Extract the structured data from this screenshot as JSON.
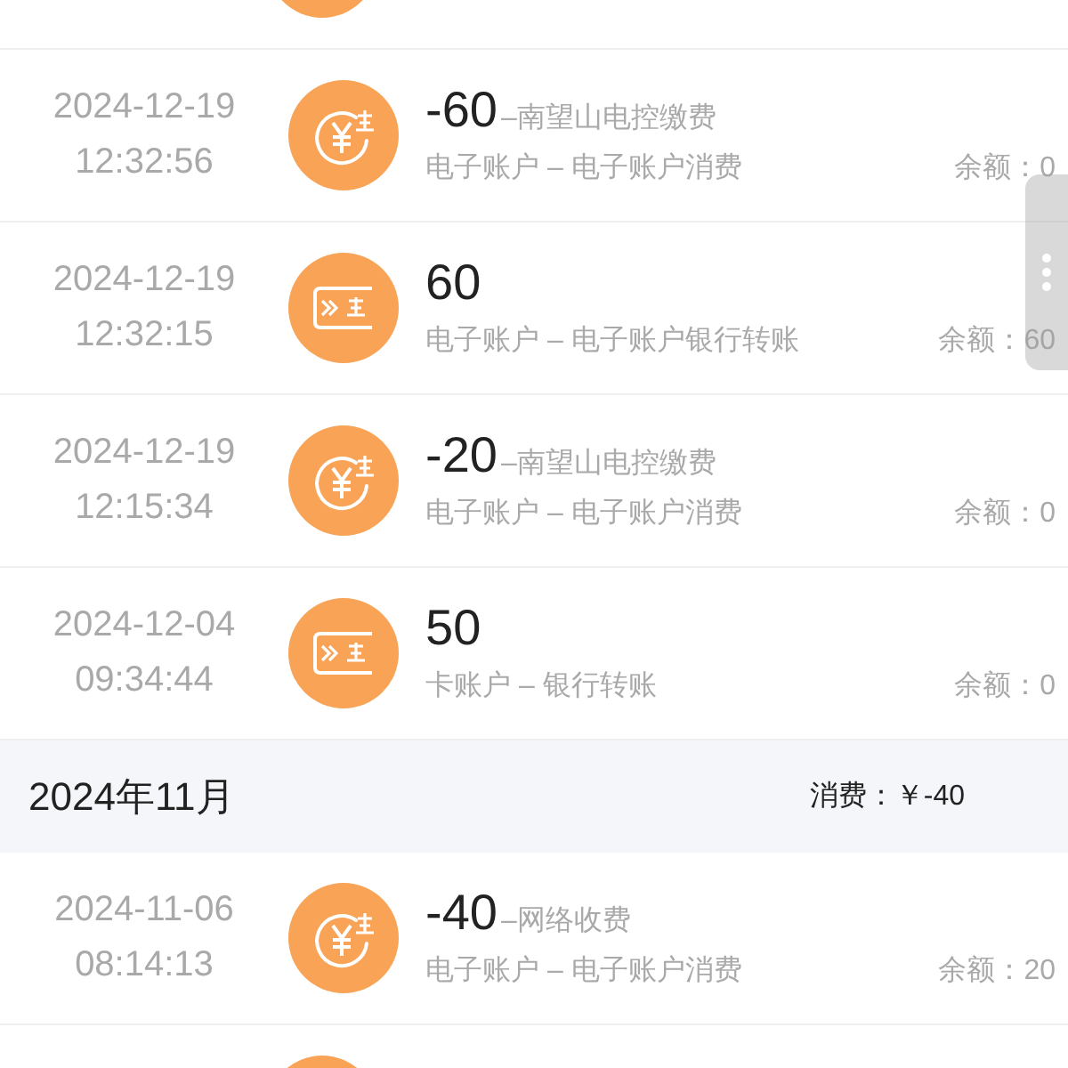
{
  "sections": [
    {
      "rows": [
        {
          "kind": "partial"
        },
        {
          "kind": "expense",
          "date": "2024-12-19",
          "time": "12:32:56",
          "amount": "-60",
          "note": "–南望山电控缴费",
          "account": "电子账户 – 电子账户消费",
          "balance": "余额：0"
        },
        {
          "kind": "transfer",
          "date": "2024-12-19",
          "time": "12:32:15",
          "amount": "60",
          "account": "电子账户 – 电子账户银行转账",
          "balance": "余额：60"
        },
        {
          "kind": "expense",
          "date": "2024-12-19",
          "time": "12:15:34",
          "amount": "-20",
          "note": "–南望山电控缴费",
          "account": "电子账户 – 电子账户消费",
          "balance": "余额：0"
        },
        {
          "kind": "transfer",
          "date": "2024-12-04",
          "time": "09:34:44",
          "amount": "50",
          "account": "卡账户 – 银行转账",
          "balance": "余额：0"
        }
      ]
    },
    {
      "month": "2024年11月",
      "summary": "消费：￥-40",
      "rows": [
        {
          "kind": "expense",
          "date": "2024-11-06",
          "time": "08:14:13",
          "amount": "-40",
          "note": "–网络收费",
          "account": "电子账户 – 电子账户消费",
          "balance": "余额：20"
        },
        {
          "kind": "partial"
        }
      ]
    }
  ]
}
